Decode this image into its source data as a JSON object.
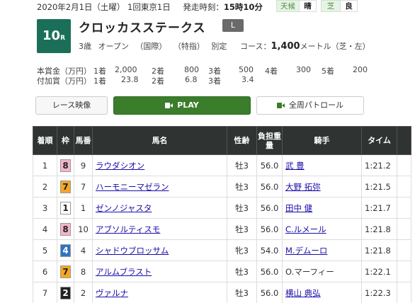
{
  "header": {
    "date_line": "2020年2月1日（土曜） 1回東京1日",
    "post_label": "発走時刻：",
    "post_time": "15時10分",
    "weather_label": "天候",
    "weather_value": "晴",
    "track_label": "芝",
    "track_value": "良"
  },
  "race": {
    "number": "10",
    "number_suffix": "R",
    "name": "クロッカスステークス",
    "grade": "L",
    "conditions": "3歳 オープン （国際） （特指） 別定",
    "course_label": "コース：",
    "course_distance": "1,400",
    "course_unit": "メートル（芝・左）"
  },
  "prize": {
    "main_label": "本賞金（万円）",
    "main": [
      {
        "place": "1着",
        "amount": "2,000"
      },
      {
        "place": "2着",
        "amount": "800"
      },
      {
        "place": "3着",
        "amount": "500"
      },
      {
        "place": "4着",
        "amount": "300"
      },
      {
        "place": "5着",
        "amount": "200"
      }
    ],
    "added_label": "付加賞（万円）",
    "added": [
      {
        "place": "1着",
        "amount": "23.8"
      },
      {
        "place": "2着",
        "amount": "6.8"
      },
      {
        "place": "3着",
        "amount": "3.4"
      }
    ]
  },
  "buttons": {
    "video": "レース映像",
    "play": "PLAY",
    "patrol": "全周パトロール"
  },
  "table": {
    "headers": {
      "rank": "着順",
      "frame": "枠",
      "horse_no": "馬番",
      "horse": "馬名",
      "sex_age": "性齢",
      "weight": "負担重量",
      "jockey": "騎手",
      "time": "タイム"
    },
    "rows": [
      {
        "rank": "1",
        "frame": "8",
        "frame_bg": "#f5b4c8",
        "frame_fg": "#222222",
        "no": "9",
        "horse": "ラウダシオン",
        "sex_age": "牡3",
        "weight": "56.0",
        "jockey": "武 豊",
        "jockey_link": true,
        "time": "1:21.2"
      },
      {
        "rank": "2",
        "frame": "7",
        "frame_bg": "#f5a623",
        "frame_fg": "#222222",
        "no": "7",
        "horse": "ハーモニーマゼラン",
        "sex_age": "牡3",
        "weight": "56.0",
        "jockey": "大野 拓弥",
        "jockey_link": true,
        "time": "1:21.5"
      },
      {
        "rank": "3",
        "frame": "1",
        "frame_bg": "#ffffff",
        "frame_fg": "#222222",
        "no": "1",
        "horse": "ゼンノジャスタ",
        "sex_age": "牡3",
        "weight": "56.0",
        "jockey": "田中 健",
        "jockey_link": true,
        "time": "1:21.7"
      },
      {
        "rank": "4",
        "frame": "8",
        "frame_bg": "#f5b4c8",
        "frame_fg": "#222222",
        "no": "10",
        "horse": "アブソルティスモ",
        "sex_age": "牡3",
        "weight": "56.0",
        "jockey": "C.ルメール",
        "jockey_link": true,
        "time": "1:21.8"
      },
      {
        "rank": "5",
        "frame": "4",
        "frame_bg": "#2f74c0",
        "frame_fg": "#ffffff",
        "no": "4",
        "horse": "シャドウブロッサム",
        "sex_age": "牝3",
        "weight": "54.0",
        "jockey": "M.デムーロ",
        "jockey_link": true,
        "time": "1:21.8"
      },
      {
        "rank": "6",
        "frame": "7",
        "frame_bg": "#f5a623",
        "frame_fg": "#222222",
        "no": "8",
        "horse": "アルムブラスト",
        "sex_age": "牡3",
        "weight": "56.0",
        "jockey": "O.マーフィー",
        "jockey_link": false,
        "time": "1:22.1"
      },
      {
        "rank": "7",
        "frame": "2",
        "frame_bg": "#222222",
        "frame_fg": "#ffffff",
        "no": "2",
        "horse": "ヴァルナ",
        "sex_age": "牡3",
        "weight": "56.0",
        "jockey": "横山 典弘",
        "jockey_link": true,
        "time": "1:22.3"
      }
    ]
  }
}
